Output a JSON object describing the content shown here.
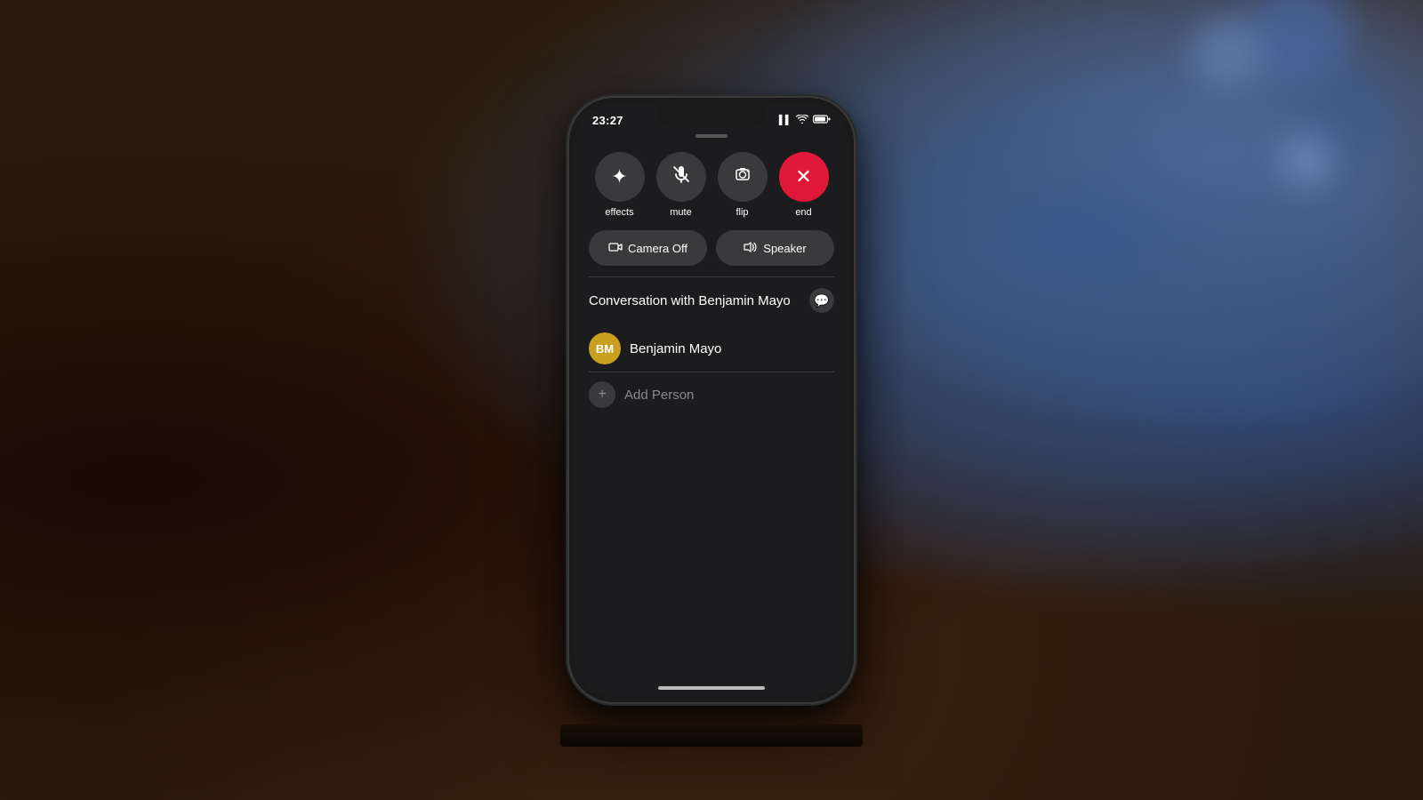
{
  "background": {
    "color": "#2a1a0a"
  },
  "status_bar": {
    "time": "23:27",
    "signal": "▌▌",
    "wifi": "WiFi",
    "battery": "🔋"
  },
  "call_controls": {
    "buttons": [
      {
        "id": "effects",
        "label": "effects",
        "icon": "✦",
        "style": "normal"
      },
      {
        "id": "mute",
        "label": "mute",
        "icon": "🎤",
        "style": "normal"
      },
      {
        "id": "flip",
        "label": "flip",
        "icon": "📷",
        "style": "normal"
      },
      {
        "id": "end",
        "label": "end",
        "icon": "✕",
        "style": "end"
      }
    ],
    "secondary_buttons": [
      {
        "id": "camera_off",
        "label": "Camera Off",
        "icon": "📷"
      },
      {
        "id": "speaker",
        "label": "Speaker",
        "icon": "🔊"
      }
    ]
  },
  "conversation": {
    "title": "Conversation with Benjamin Mayo",
    "person": {
      "name": "Benjamin Mayo",
      "initials": "BM",
      "avatar_color": "#c9a020"
    },
    "add_person_label": "Add Person"
  },
  "home_indicator": true
}
